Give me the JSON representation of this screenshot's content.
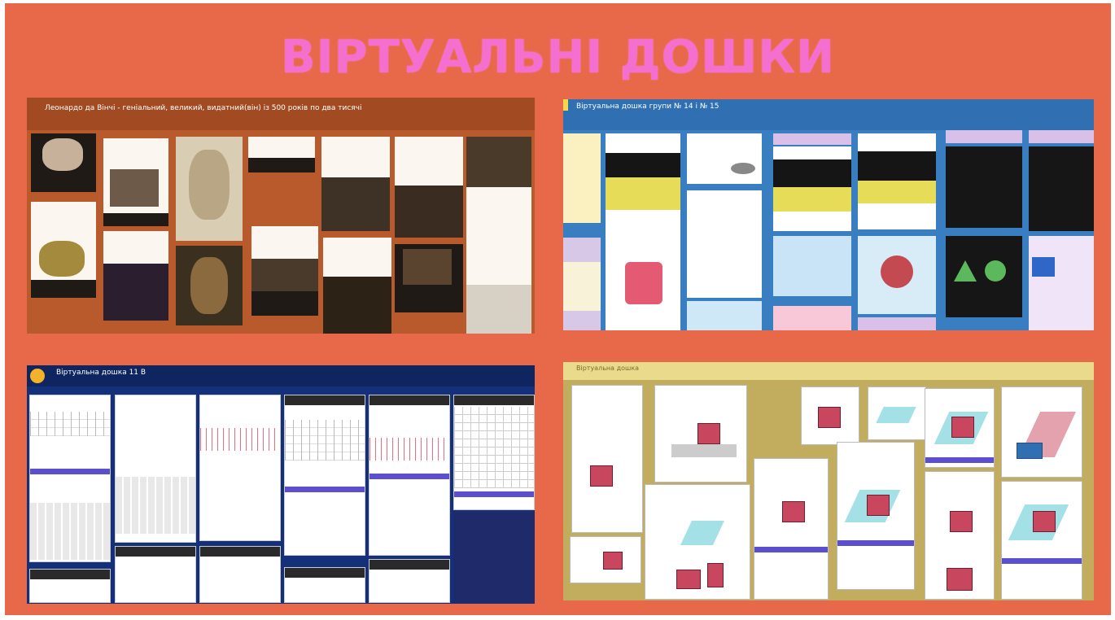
{
  "slide": {
    "title": "ВІРТУАЛЬНІ ДОШКИ",
    "background_color": "#e8684a",
    "title_color": "#f46fd0"
  },
  "boards": [
    {
      "name": "leonardo-board",
      "header": "Леонардо да Вінчі - геніальний, великий, видатний(він) із 500 років по два тисячі",
      "color": "#b85a2c"
    },
    {
      "name": "geometry-board",
      "header": "Віртуальна дошка групи № 14 і № 15",
      "color": "#3a7ec2"
    },
    {
      "name": "graphs-board",
      "header": "Віртуальна дошка 11 В",
      "color": "#14307a"
    },
    {
      "name": "cubes-board",
      "header": "Віртуальна дошка",
      "color": "#c2ac5e"
    }
  ]
}
